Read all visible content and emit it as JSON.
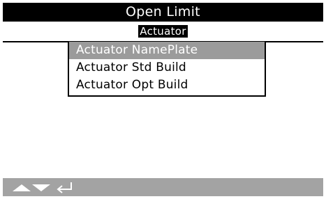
{
  "header": {
    "title": "Open Limit",
    "breadcrumb": "Actuator"
  },
  "menu": {
    "items": [
      {
        "label": "Actuator NamePlate",
        "selected": true
      },
      {
        "label": "Actuator Std Build",
        "selected": false
      },
      {
        "label": "Actuator Opt Build",
        "selected": false
      }
    ]
  },
  "footer": {
    "icons": [
      "up-arrow-icon",
      "down-arrow-icon",
      "enter-icon"
    ]
  },
  "colors": {
    "title_bg": "#000000",
    "selected_bg": "#9b9b9b",
    "footer_bg": "#a3a3a3"
  }
}
